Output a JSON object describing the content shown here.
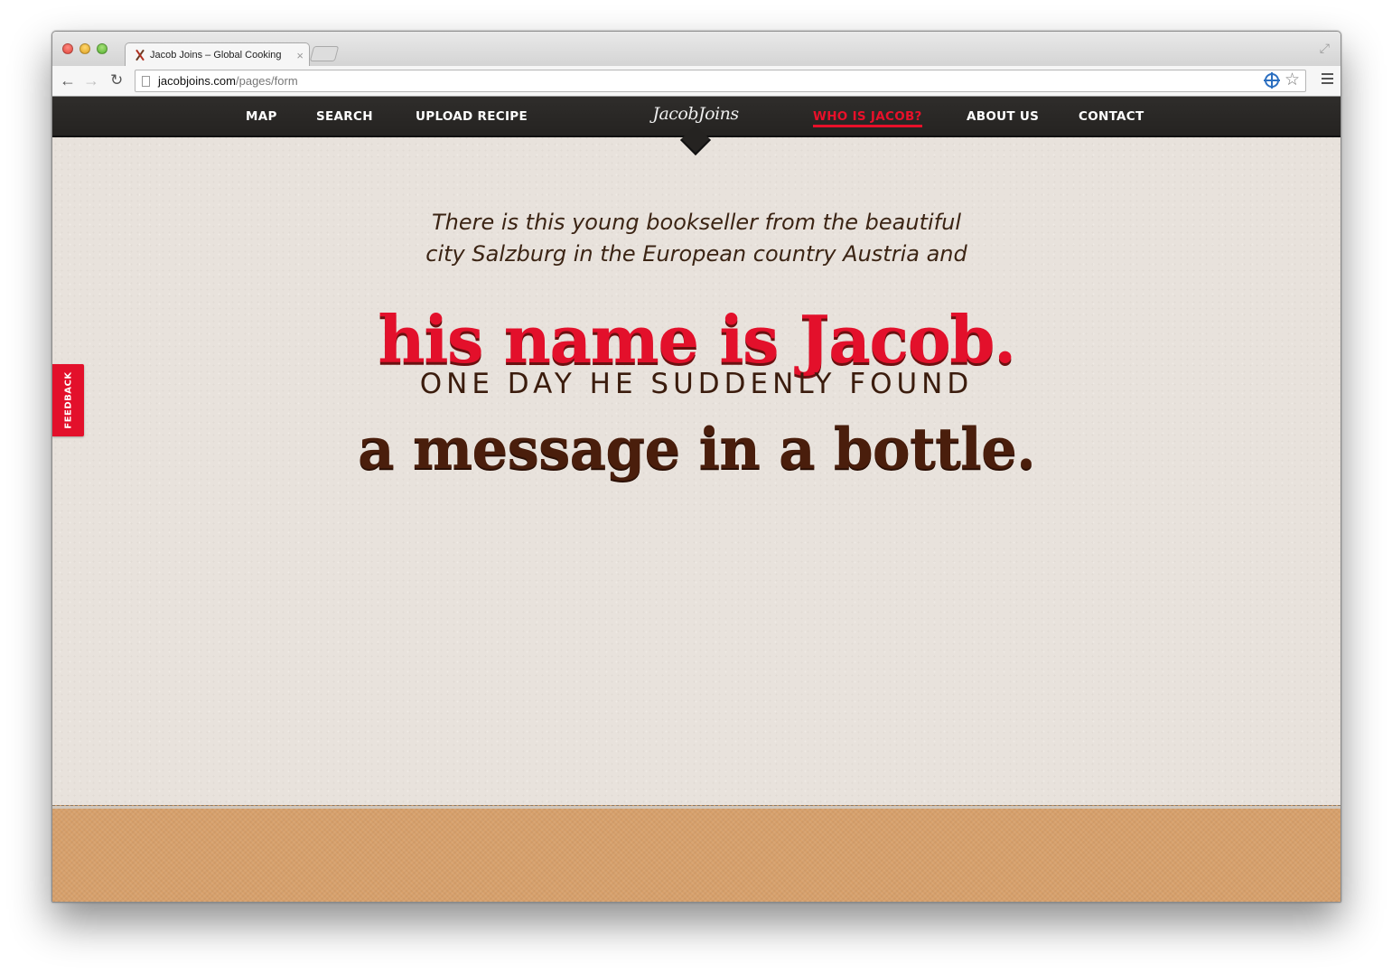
{
  "browser": {
    "tab_title": "Jacob Joins – Global Cooking",
    "tab_close": "×",
    "url_host": "jacobjoins.com",
    "url_path": "/pages/form"
  },
  "site_nav": {
    "left_links": [
      "MAP",
      "SEARCH",
      "UPLOAD RECIPE"
    ],
    "logo": "JacobJoins",
    "right_links": [
      "WHO IS JACOB?",
      "ABOUT US",
      "CONTACT"
    ],
    "active_link": "WHO IS JACOB?",
    "active_color": "#e3102b",
    "nav_background": "#2b2927"
  },
  "feedback_tab": "FEEDBACK",
  "story": {
    "intro_line1": "There is this young bookseller from the beautiful",
    "intro_line2": "city Salzburg in the European country Austria and",
    "headline": "his name is Jacob.",
    "caps_line": "ONE DAY HE SUDDENLY FOUND",
    "headline2": "a message in a bottle."
  },
  "colors": {
    "page_background": "#e8e2dc",
    "headline_red": "#e3102b",
    "text_brown": "#4a1e0c",
    "footer_tan": "#d7a06b"
  },
  "icons": {
    "back": "back-arrow-icon",
    "forward": "forward-arrow-icon",
    "reload": "reload-icon",
    "page": "page-icon",
    "extension": "crosshair-icon",
    "bookmark": "star-icon",
    "menu": "hamburger-menu-icon",
    "fullscreen": "fullscreen-icon"
  }
}
